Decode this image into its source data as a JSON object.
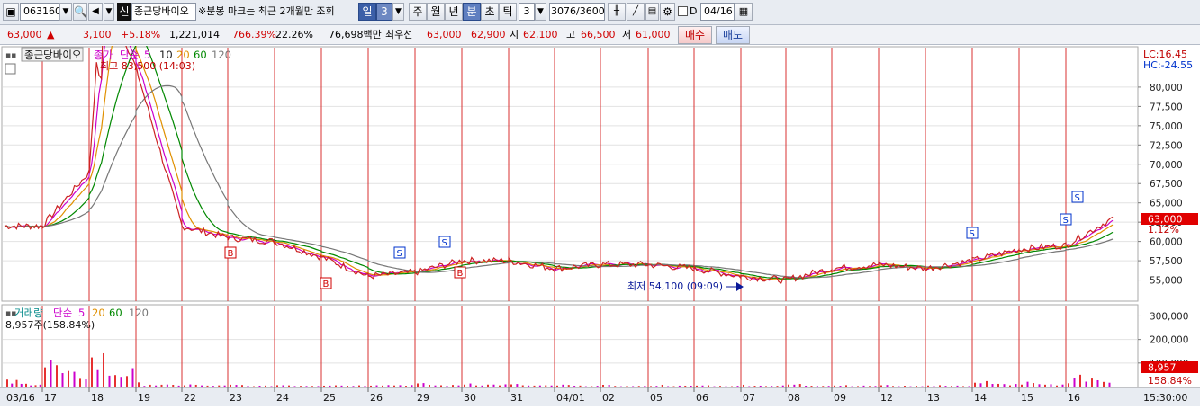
{
  "toolbar": {
    "code": "063160",
    "name_prefix": "신",
    "name": "종근당바이오",
    "notice": "※분봉 마크는 최근 2개월만 조회",
    "period_day": "일",
    "period_count": "3",
    "btn_week": "주",
    "btn_month": "월",
    "btn_year": "년",
    "btn_min": "분",
    "btn_sec": "초",
    "btn_tick": "틱",
    "tick_value": "3",
    "data_count": "3076",
    "data_max": "/3600",
    "check_label": "D",
    "date_value": "04/16"
  },
  "quote": {
    "price": "63,000",
    "arrow": "▲",
    "change": "3,100",
    "change_pct": "+5.18%",
    "volume": "1,221,014",
    "vol_ratio": "766.39%",
    "turnover": "22.26%",
    "amount": "76,698백만",
    "best_label": "최우선",
    "best_ask": "63,000",
    "best_bid": "62,900",
    "open_label": "시",
    "open": "62,100",
    "high_label": "고",
    "high": "66,500",
    "low_label": "저",
    "low": "61,000",
    "buy_label": "매수",
    "sell_label": "매도"
  },
  "price_pane": {
    "legend_name": "종근당바이오",
    "legend_close": "종가",
    "legend_ma": "단순",
    "ma": [
      "5",
      "10",
      "20",
      "60",
      "120"
    ],
    "lc": "LC:16.45",
    "hc": "HC:-24.55",
    "high_note": "최고 83,500 (14:03)",
    "low_note": "최저 54,100 (09:09)",
    "current_price": "63,000",
    "current_pct": "1.12%",
    "marks": [
      "B",
      "B",
      "S",
      "S",
      "B",
      "S",
      "S",
      "S"
    ]
  },
  "volume_pane": {
    "legend_name": "거래량",
    "legend_ma": "단순",
    "ma": [
      "5",
      "20",
      "60",
      "120"
    ],
    "volume_note": "8,957주(158.84%)",
    "current_volume": "8,957",
    "current_pct": "158.84%"
  },
  "x_axis": {
    "labels": [
      "03/16",
      "17",
      "18",
      "19",
      "22",
      "23",
      "24",
      "25",
      "26",
      "29",
      "30",
      "31",
      "04/01",
      "02",
      "05",
      "06",
      "07",
      "08",
      "09",
      "12",
      "13",
      "14",
      "15",
      "16"
    ],
    "time": "15:30:00"
  },
  "chart_data": [
    {
      "type": "line",
      "title": "",
      "series": [
        {
          "name": "종가",
          "values": [
            62000,
            69000,
            82500,
            62000,
            60500,
            60000,
            58000,
            55500,
            56000,
            57500,
            57500,
            56500,
            57000,
            57000,
            56500,
            55500,
            55000,
            56500,
            57000,
            56500,
            57500,
            59000,
            59500,
            63000
          ]
        }
      ],
      "y_ticks": [
        "80,000",
        "77,500",
        "75,000",
        "72,500",
        "70,000",
        "67,500",
        "65,000",
        "62,500",
        "60,000",
        "57,500",
        "55,000"
      ],
      "ylim": [
        52500,
        85000
      ]
    },
    {
      "type": "bar",
      "title": "",
      "series": [
        {
          "name": "거래량",
          "values": [
            20000,
            90000,
            110000,
            12000,
            8000,
            6000,
            7000,
            9000,
            12000,
            10000,
            15000,
            8000,
            6000,
            5000,
            6000,
            5000,
            7000,
            9000,
            6000,
            5000,
            6000,
            18000,
            14000,
            50000
          ]
        }
      ],
      "y_ticks": [
        "300,000",
        "200,000",
        "100,000"
      ],
      "ylim": [
        0,
        340000
      ]
    }
  ]
}
